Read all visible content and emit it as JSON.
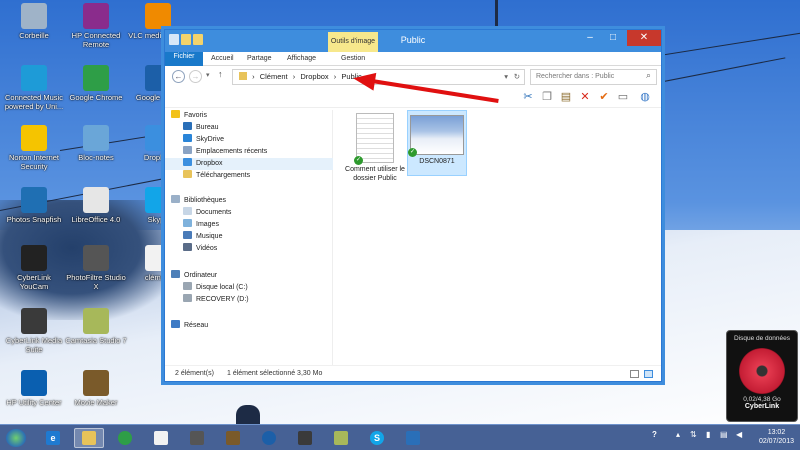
{
  "desktop": {
    "icons": [
      {
        "label": "Corbeille",
        "icon": "recycle-bin-icon",
        "color": "#9fb3c8"
      },
      {
        "label": "HP Connected Remote",
        "icon": "hp-connected-remote-icon",
        "color": "#8a2c8c"
      },
      {
        "label": "VLC media player",
        "icon": "vlc-icon",
        "color": "#f08a00"
      },
      {
        "label": "Connected Music powered by Uni...",
        "icon": "connected-music-icon",
        "color": "#1e9bd7"
      },
      {
        "label": "Google Chrome",
        "icon": "chrome-icon",
        "color": "#2e9e47"
      },
      {
        "label": "Google Earth",
        "icon": "google-earth-icon",
        "color": "#1c5fa8"
      },
      {
        "label": "Norton Internet Security",
        "icon": "norton-icon",
        "color": "#f5c400"
      },
      {
        "label": "Bloc-notes",
        "icon": "notepad-icon",
        "color": "#6aa6d8"
      },
      {
        "label": "Dropbox",
        "icon": "dropbox-icon",
        "color": "#3b8fdf"
      },
      {
        "label": "Photos Snapfish",
        "icon": "snapfish-icon",
        "color": "#1f6fb3"
      },
      {
        "label": "LibreOffice 4.0",
        "icon": "libreoffice-icon",
        "color": "#e6e6e6"
      },
      {
        "label": "Skype",
        "icon": "skype-icon",
        "color": "#12a5e8"
      },
      {
        "label": "CyberLink YouCam",
        "icon": "youcam-icon",
        "color": "#222222"
      },
      {
        "label": "PhotoFiltre Studio X",
        "icon": "photofiltre-icon",
        "color": "#555555"
      },
      {
        "label": "clément",
        "icon": "text-file-icon",
        "color": "#f2f2f2"
      },
      {
        "label": "CyberLink Media Suite",
        "icon": "media-suite-icon",
        "color": "#3a3a3a"
      },
      {
        "label": "Camtasia Studio 7",
        "icon": "camtasia-icon",
        "color": "#a7b85a"
      },
      {
        "label": "HP Utility Center",
        "icon": "hp-icon",
        "color": "#0a5fb0"
      },
      {
        "label": "Movie Maker",
        "icon": "movie-maker-icon",
        "color": "#7a5a2a"
      }
    ]
  },
  "explorer": {
    "title": "Public",
    "context_tab": "Outils d'image",
    "ribbon_tabs": [
      "Fichier",
      "Accueil",
      "Partage",
      "Affichage",
      "Gestion"
    ],
    "breadcrumbs": [
      "Clément",
      "Dropbox",
      "Public"
    ],
    "search_placeholder": "Rechercher dans : Public",
    "nav": {
      "favorites_header": "Favoris",
      "favorites": [
        "Bureau",
        "SkyDrive",
        "Emplacements récents",
        "Dropbox",
        "Téléchargements"
      ],
      "libraries_header": "Bibliothèques",
      "libraries": [
        "Documents",
        "Images",
        "Musique",
        "Vidéos"
      ],
      "computer_header": "Ordinateur",
      "drives": [
        "Disque local (C:)",
        "RECOVERY (D:)"
      ],
      "network_header": "Réseau"
    },
    "files": [
      {
        "name": "Comment utiliser le dossier Public",
        "type": "document"
      },
      {
        "name": "DSCN0871",
        "type": "photo"
      }
    ],
    "status": {
      "count": "2 élément(s)",
      "selection": "1 élément sélectionné  3,30 Mo"
    }
  },
  "gadget": {
    "title": "Disque de données",
    "size": "0,02/4,38 Go",
    "brand": "CyberLink"
  },
  "taskbar": {
    "clock_time": "13:02",
    "clock_date": "02/07/2013"
  }
}
